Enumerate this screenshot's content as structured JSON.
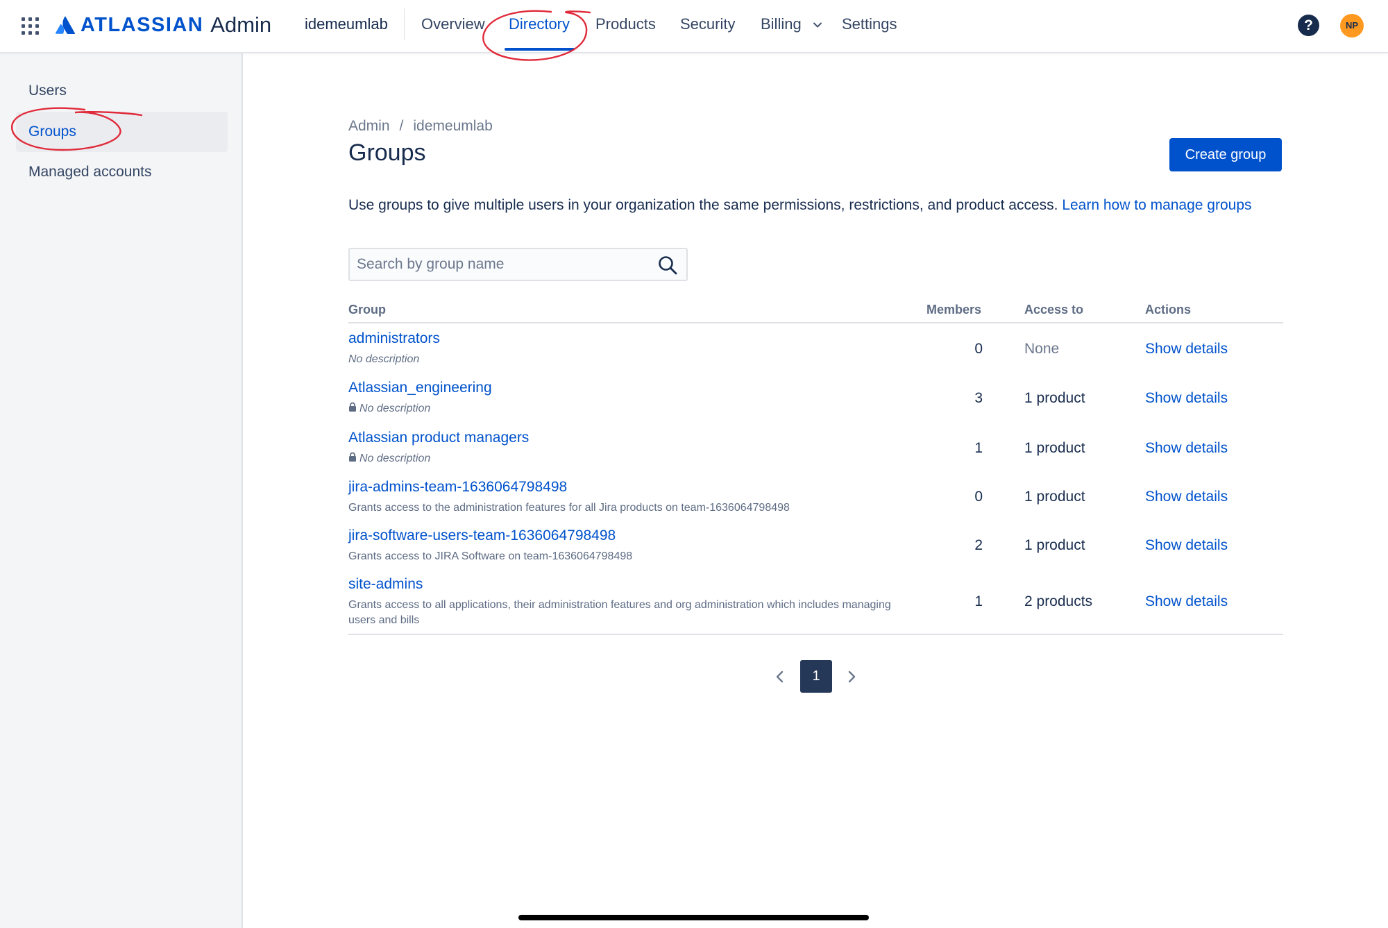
{
  "header": {
    "brand": "ATLASSIAN",
    "product": "Admin",
    "org": "idemeumlab",
    "nav": [
      {
        "label": "Overview"
      },
      {
        "label": "Directory"
      },
      {
        "label": "Products"
      },
      {
        "label": "Security"
      },
      {
        "label": "Billing"
      },
      {
        "label": "Settings"
      }
    ],
    "active_nav": "Directory",
    "help": "?",
    "avatar_initials": "NP",
    "colors": {
      "brand": "#0052CC",
      "avatar": "#FF991F"
    }
  },
  "sidebar": {
    "items": [
      {
        "label": "Users"
      },
      {
        "label": "Groups"
      },
      {
        "label": "Managed accounts"
      }
    ],
    "active": "Groups"
  },
  "main": {
    "breadcrumb": [
      "Admin",
      "idemeumlab"
    ],
    "breadcrumb_separator": "/",
    "title": "Groups",
    "create_button": "Create group",
    "intro_text": "Use groups to give multiple users in your organization the same permissions, restrictions, and product access.",
    "intro_link": "Learn how to manage groups",
    "search": {
      "placeholder": "Search by group name",
      "value": ""
    },
    "table": {
      "headers": [
        "Group",
        "Members",
        "Access to",
        "Actions"
      ],
      "rows": [
        {
          "name": "administrators",
          "description": "No description",
          "locked": false,
          "members": "0",
          "access": "None",
          "action": "Show details"
        },
        {
          "name": "Atlassian_engineering",
          "description": "No description",
          "locked": true,
          "members": "3",
          "access": "1 product",
          "action": "Show details"
        },
        {
          "name": "Atlassian product managers",
          "description": "No description",
          "locked": true,
          "members": "1",
          "access": "1 product",
          "action": "Show details"
        },
        {
          "name": "jira-admins-team-1636064798498",
          "description": "Grants access to the administration features for all Jira products on team-1636064798498",
          "locked": false,
          "members": "0",
          "access": "1 product",
          "action": "Show details"
        },
        {
          "name": "jira-software-users-team-1636064798498",
          "description": "Grants access to JIRA Software on team-1636064798498",
          "locked": false,
          "members": "2",
          "access": "1 product",
          "action": "Show details"
        },
        {
          "name": "site-admins",
          "description": "Grants access to all applications, their administration features and org administration which includes managing users and bills",
          "locked": false,
          "members": "1",
          "access": "2 products",
          "action": "Show details"
        }
      ]
    },
    "pagination": {
      "current": "1"
    }
  },
  "annotation_color": "#E02A3A"
}
